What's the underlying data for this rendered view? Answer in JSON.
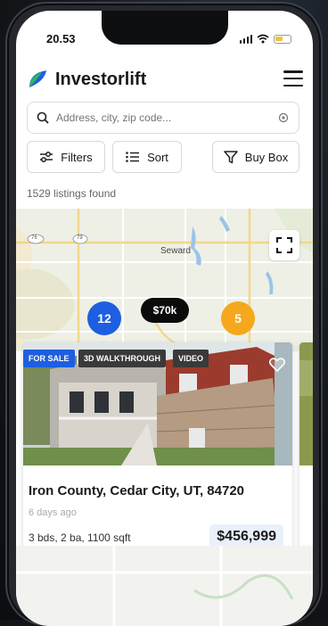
{
  "status": {
    "time": "20.53"
  },
  "header": {
    "app_name": "Investorlift"
  },
  "search": {
    "placeholder": "Address, city, zip code..."
  },
  "toolbar": {
    "filters_label": "Filters",
    "sort_label": "Sort",
    "buybox_label": "Buy Box"
  },
  "results": {
    "count_text": "1529 listings found"
  },
  "map": {
    "place_label": "Seward",
    "route_a": "76",
    "route_b": "79",
    "clusters": [
      {
        "label": "12",
        "color": "#1d5fe0"
      },
      {
        "label": "5",
        "color": "#f5a81c"
      }
    ],
    "price_pin": "$70k"
  },
  "listing": {
    "tags": [
      "FOR SALE",
      "3D WALKTHROUGH",
      "VIDEO"
    ],
    "tag_colors": [
      "#1d5fe0",
      "#3a3a3a",
      "#3a3a3a"
    ],
    "address": "Iron County, Cedar City, UT, 84720",
    "posted": "6 days ago",
    "specs": "3 bds, 2 ba, 1100 sqft",
    "price": "$456,999"
  },
  "colors": {
    "brand_blue": "#1d5fe0",
    "brand_green": "#2fb65a",
    "accent_orange": "#f5a81c"
  }
}
